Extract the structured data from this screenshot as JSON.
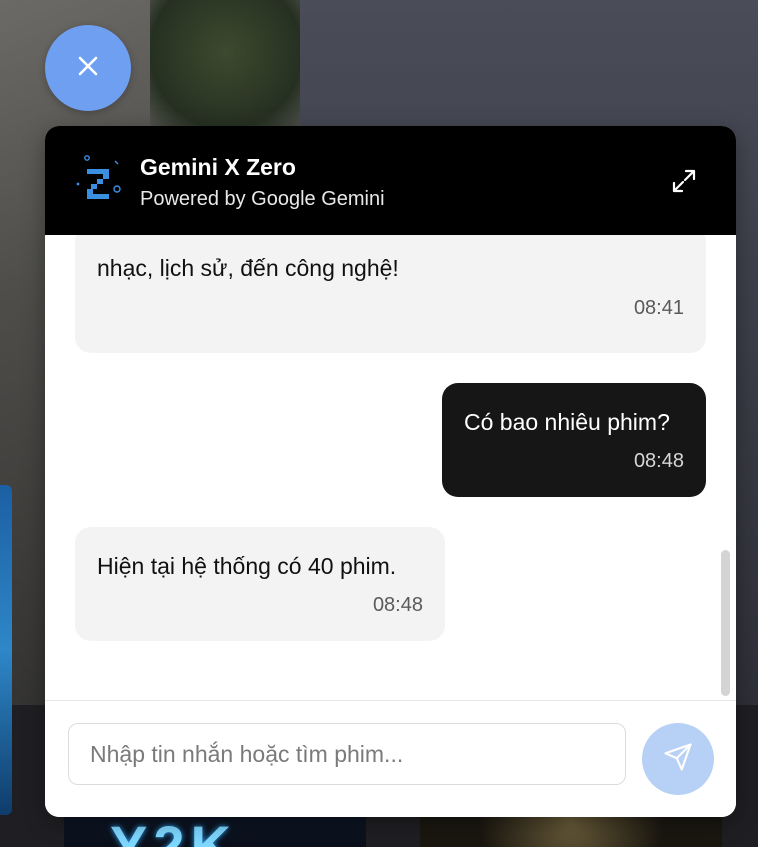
{
  "chat": {
    "title": "Gemini X Zero",
    "subtitle": "Powered by Google Gemini",
    "messages": [
      {
        "sender": "bot",
        "text": "nhạc, lịch sử, đến công nghệ!",
        "time": "08:41"
      },
      {
        "sender": "user",
        "text": "Có bao nhiêu phim?",
        "time": "08:48"
      },
      {
        "sender": "bot",
        "text": "Hiện tại hệ thống có 40 phim.",
        "time": "08:48"
      }
    ],
    "input_placeholder": "Nhập tin nhắn hoặc tìm phim...",
    "input_value": ""
  },
  "background": {
    "poster_text": "Y2K"
  },
  "colors": {
    "accent": "#6f9ff0",
    "header_bg": "#000000",
    "user_bubble": "#161616",
    "bot_bubble": "#f3f3f3",
    "send_button": "#b7d0f5"
  },
  "icons": {
    "close": "close-icon",
    "expand": "expand-icon",
    "send": "send-icon",
    "logo": "zero-logo-icon"
  }
}
